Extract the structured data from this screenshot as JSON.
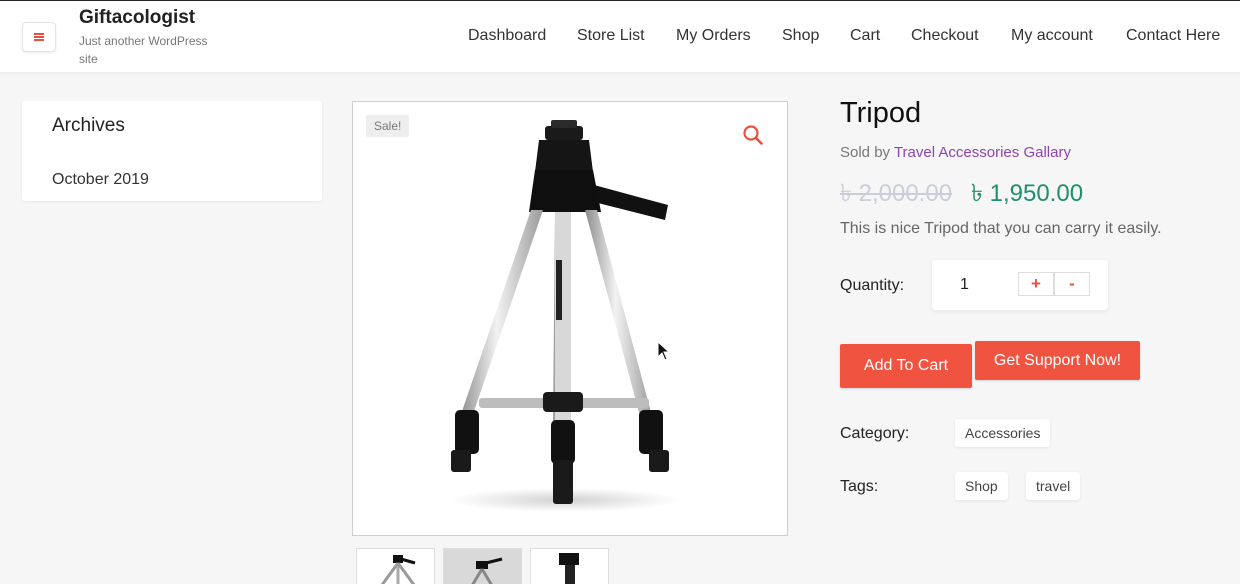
{
  "site": {
    "title": "Giftacologist",
    "description": "Just another WordPress site"
  },
  "nav": {
    "items": [
      "Dashboard",
      "Store List",
      "My Orders",
      "Shop",
      "Cart",
      "Checkout",
      "My account",
      "Contact Here"
    ]
  },
  "sidebar": {
    "widget_title": "Archives",
    "archive_link": "October 2019"
  },
  "gallery": {
    "sale_badge": "Sale!",
    "icons": [
      "search-icon"
    ],
    "thumbnail_count": 3
  },
  "product": {
    "title": "Tripod",
    "sold_by_prefix": "Sold by",
    "vendor": "Travel Accessories Gallary",
    "regular_price": "৳ 2,000.00",
    "sale_price": "৳ 1,950.00",
    "short_description": "This is nice Tripod that you can carry it easily.",
    "quantity_label": "Quantity:",
    "quantity": "1",
    "plus": "+",
    "minus": "-",
    "add_to_cart": "Add To Cart",
    "support": "Get Support Now!",
    "category_label": "Category:",
    "category": "Accessories",
    "tags_label": "Tags:",
    "tags": [
      "Shop",
      "travel"
    ]
  },
  "colors": {
    "accent": "#f05440",
    "sale_price": "#1f8f6f",
    "vendor_link": "#8e44ad"
  }
}
